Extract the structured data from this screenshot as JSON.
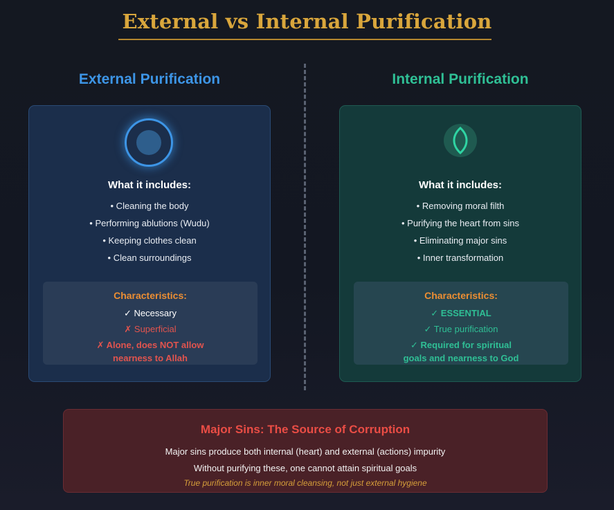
{
  "title": "External vs Internal Purification",
  "external": {
    "heading": "External Purification",
    "icon": "circle-ring-icon",
    "includes_label": "What it includes:",
    "items": [
      "• Cleaning the body",
      "• Performing ablutions (Wudu)",
      "• Keeping clothes clean",
      "• Clean surroundings"
    ],
    "characteristics": {
      "label": "Characteristics:",
      "lines": [
        "✓ Necessary",
        "✗ Superficial",
        "✗ Alone, does NOT allow",
        "nearness to Allah"
      ]
    }
  },
  "internal": {
    "heading": "Internal Purification",
    "icon": "leaf-icon",
    "includes_label": "What it includes:",
    "items": [
      "• Removing moral filth",
      "• Purifying the heart from sins",
      "• Eliminating major sins",
      "• Inner transformation"
    ],
    "characteristics": {
      "label": "Characteristics:",
      "lines": [
        "✓ ESSENTIAL",
        "✓ True purification",
        "✓ Required for spiritual",
        "goals and nearness to God"
      ]
    }
  },
  "bottom": {
    "title": "Major Sins: The Source of Corruption",
    "lines": [
      "Major sins produce both internal (heart) and external (actions) impurity",
      "Without purifying these, one cannot attain spiritual goals"
    ],
    "note": "True purification is inner moral cleansing, not just external hygiene"
  },
  "colors": {
    "gold": "#d9a63c",
    "blue": "#3d95e6",
    "green": "#2fbf95",
    "orange": "#ec8e33",
    "red": "#e2544e"
  }
}
